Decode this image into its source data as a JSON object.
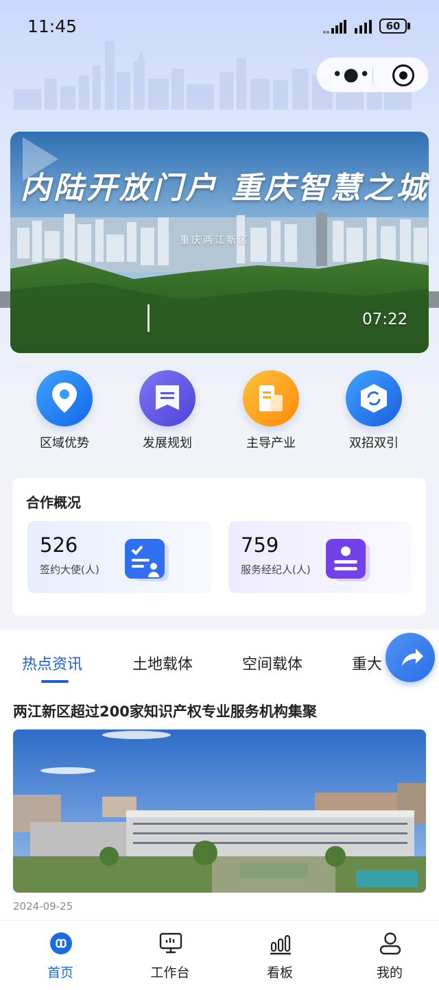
{
  "status_bar": {
    "time": "11:45",
    "battery": "60"
  },
  "banner": {
    "title": "内陆开放门户 重庆智慧之城",
    "subtitle": "重庆两江新区",
    "duration": "07:22"
  },
  "quick_links": [
    {
      "label": "区域优势",
      "icon": "location-pin-icon"
    },
    {
      "label": "发展规划",
      "icon": "bookmark-doc-icon"
    },
    {
      "label": "主导产业",
      "icon": "building-doc-icon"
    },
    {
      "label": "双招双引",
      "icon": "exchange-hexagon-icon"
    }
  ],
  "cooperation": {
    "title": "合作概况",
    "stats": [
      {
        "value": "526",
        "label": "签约大使(人)",
        "icon": "checklist-person-icon"
      },
      {
        "value": "759",
        "label": "服务经纪人(人)",
        "icon": "badge-card-icon"
      }
    ]
  },
  "news": {
    "tabs": [
      "热点资讯",
      "土地载体",
      "空间载体",
      "重大"
    ],
    "active_tab": 0,
    "headline": "两江新区超过200家知识产权专业服务机构集聚",
    "date": "2024-09-25"
  },
  "tabbar": [
    {
      "label": "首页",
      "icon": "home-infinity-icon",
      "active": true
    },
    {
      "label": "工作台",
      "icon": "monitor-icon",
      "active": false
    },
    {
      "label": "看板",
      "icon": "bar-chart-icon",
      "active": false
    },
    {
      "label": "我的",
      "icon": "person-icon",
      "active": false
    }
  ],
  "colors": {
    "accent": "#1a6ae3",
    "share": "#2a6fe6"
  }
}
